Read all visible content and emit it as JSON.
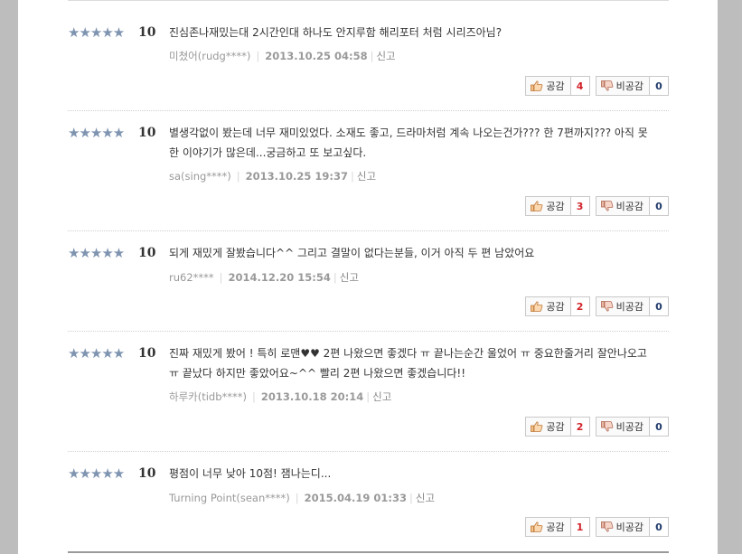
{
  "reviews": [
    {
      "stars": "★★★★★",
      "score": "10",
      "text": "진심존나재밌는대 2시간인대 하나도 안지루함 해리포터 처럼 시리즈아님?",
      "user": "미쳤어(rudg****)",
      "date": "2013.10.25 04:58",
      "report": "신고",
      "agree_label": "공감",
      "agree_count": "4",
      "disagree_label": "비공감",
      "disagree_count": "0"
    },
    {
      "stars": "★★★★★",
      "score": "10",
      "text": "별생각없이 봤는데 너무 재미있었다. 소재도 좋고, 드라마처럼 계속 나오는건가??? 한 7편까지??? 아직 못한 이야기가 많은데...궁금하고 또 보고싶다.",
      "user": "sa(sing****)",
      "date": "2013.10.25 19:37",
      "report": "신고",
      "agree_label": "공감",
      "agree_count": "3",
      "disagree_label": "비공감",
      "disagree_count": "0"
    },
    {
      "stars": "★★★★★",
      "score": "10",
      "text": "되게 재밌게 잘봤습니다^^ 그리고 결말이 없다는분들, 이거 아직 두 편 남았어요",
      "user": "ru62****",
      "date": "2014.12.20 15:54",
      "report": "신고",
      "agree_label": "공감",
      "agree_count": "2",
      "disagree_label": "비공감",
      "disagree_count": "0"
    },
    {
      "stars": "★★★★★",
      "score": "10",
      "text": "진짜 재밌게 봤어 ! 특히 로맨♥♥ 2편 나왔으면 좋겠다 ㅠ 끝나는순간 울었어 ㅠ 중요한줄거리 잘안나오고 ㅠ 끝났다 하지만 좋았어요~^^ 빨리 2편 나왔으면 좋겠습니다!!",
      "user": "하루카(tidb****)",
      "date": "2013.10.18 20:14",
      "report": "신고",
      "agree_label": "공감",
      "agree_count": "2",
      "disagree_label": "비공감",
      "disagree_count": "0"
    },
    {
      "stars": "★★★★★",
      "score": "10",
      "text": "평점이 너무 낮아 10점! 잼나는디...",
      "user": "Turning Point(sean****)",
      "date": "2015.04.19 01:33",
      "report": "신고",
      "agree_label": "공감",
      "agree_count": "1",
      "disagree_label": "비공감",
      "disagree_count": "0"
    }
  ]
}
